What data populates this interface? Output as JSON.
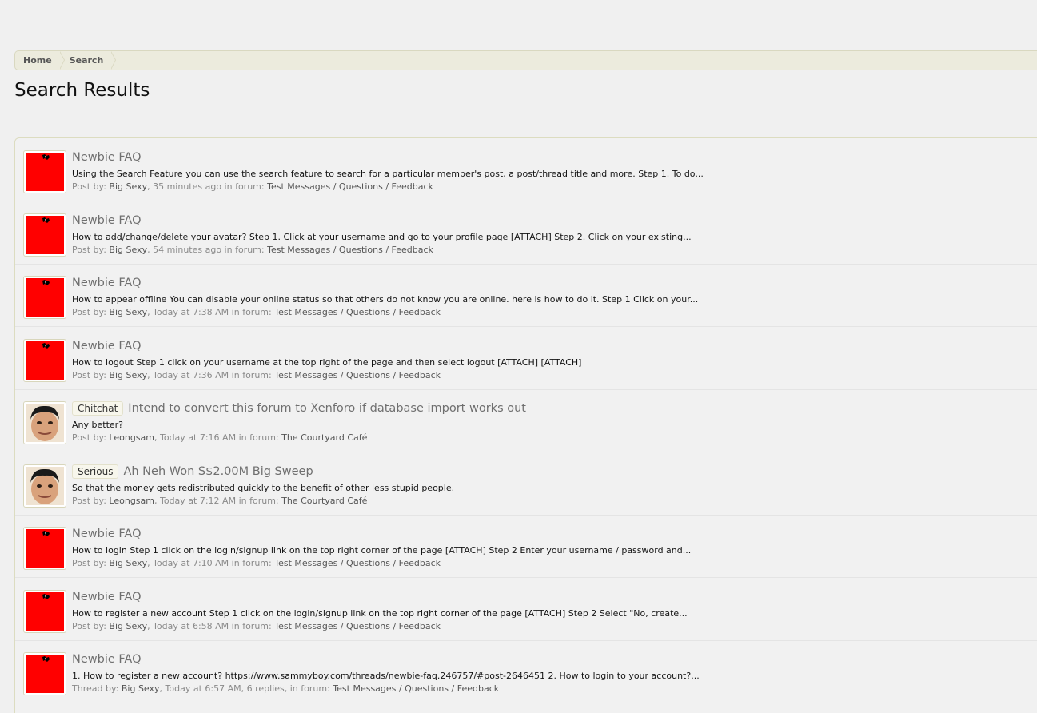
{
  "breadcrumb": {
    "home": "Home",
    "search": "Search"
  },
  "page_title": "Search Results",
  "results": [
    {
      "avatar": "red-avatar-icon",
      "prefix": "",
      "title": "Newbie FAQ",
      "snippet": "Using the Search Feature you can use the search feature to search for a particular member's post, a post/thread title and more. Step 1. To do...",
      "type_label": "Post by:",
      "author": "Big Sexy",
      "time": ", 35 minutes ago",
      "replies": "",
      "in_forum": " in forum:",
      "forum": "Test Messages / Questions / Feedback"
    },
    {
      "avatar": "red-avatar-icon",
      "prefix": "",
      "title": "Newbie FAQ",
      "snippet": "How to add/change/delete your avatar? Step 1. Click at your username and go to your profile page [ATTACH] Step 2. Click on your existing...",
      "type_label": "Post by:",
      "author": "Big Sexy",
      "time": ", 54 minutes ago",
      "replies": "",
      "in_forum": " in forum:",
      "forum": "Test Messages / Questions / Feedback"
    },
    {
      "avatar": "red-avatar-icon",
      "prefix": "",
      "title": "Newbie FAQ",
      "snippet": "How to appear offline You can disable your online status so that others do not know you are online. here is how to do it. Step 1 Click on your...",
      "type_label": "Post by:",
      "author": "Big Sexy",
      "time": ", Today at 7:38 AM",
      "replies": "",
      "in_forum": " in forum:",
      "forum": "Test Messages / Questions / Feedback"
    },
    {
      "avatar": "red-avatar-icon",
      "prefix": "",
      "title": "Newbie FAQ",
      "snippet": "How to logout Step 1 click on your username at the top right of the page and then select logout [ATTACH] [ATTACH]",
      "type_label": "Post by:",
      "author": "Big Sexy",
      "time": ", Today at 7:36 AM",
      "replies": "",
      "in_forum": " in forum:",
      "forum": "Test Messages / Questions / Feedback"
    },
    {
      "avatar": "face-avatar-icon",
      "prefix": "Chitchat",
      "title": "Intend to convert this forum to Xenforo if database import works out",
      "snippet": "Any better?",
      "type_label": "Post by:",
      "author": "Leongsam",
      "time": ", Today at 7:16 AM",
      "replies": "",
      "in_forum": " in forum:",
      "forum": "The Courtyard Café"
    },
    {
      "avatar": "face-avatar-icon",
      "prefix": "Serious",
      "title": "Ah Neh Won S$2.00M Big Sweep",
      "snippet": "So that the money gets redistributed quickly to the benefit of other less stupid people.",
      "type_label": "Post by:",
      "author": "Leongsam",
      "time": ", Today at 7:12 AM",
      "replies": "",
      "in_forum": " in forum:",
      "forum": "The Courtyard Café"
    },
    {
      "avatar": "red-avatar-icon",
      "prefix": "",
      "title": "Newbie FAQ",
      "snippet": "How to login Step 1 click on the login/signup link on the top right corner of the page [ATTACH] Step 2 Enter your username / password and...",
      "type_label": "Post by:",
      "author": "Big Sexy",
      "time": ", Today at 7:10 AM",
      "replies": "",
      "in_forum": " in forum:",
      "forum": "Test Messages / Questions / Feedback"
    },
    {
      "avatar": "red-avatar-icon",
      "prefix": "",
      "title": "Newbie FAQ",
      "snippet": "How to register a new account Step 1 click on the login/signup link on the top right corner of the page [ATTACH] Step 2 Select \"No, create...",
      "type_label": "Post by:",
      "author": "Big Sexy",
      "time": ", Today at 6:58 AM",
      "replies": "",
      "in_forum": " in forum:",
      "forum": "Test Messages / Questions / Feedback"
    },
    {
      "avatar": "red-avatar-icon",
      "prefix": "",
      "title": "Newbie FAQ",
      "snippet": "1. How to register a new account? https://www.sammyboy.com/threads/newbie-faq.246757/#post-2646451 2. How to login to your account?...",
      "type_label": "Thread by:",
      "author": "Big Sexy",
      "time": ", Today at 6:57 AM,",
      "replies": " 6 replies,",
      "in_forum": " in forum:",
      "forum": "Test Messages / Questions / Feedback"
    }
  ]
}
